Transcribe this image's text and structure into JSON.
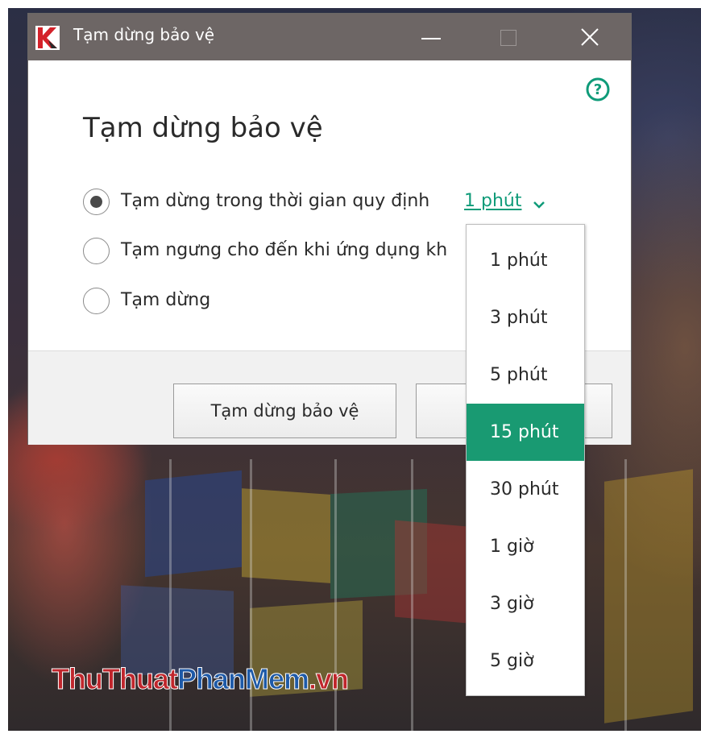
{
  "window": {
    "title": "Tạm dừng bảo vệ",
    "icon": "kaspersky-logo-icon",
    "controls": [
      "minimize-icon",
      "maximize-icon",
      "close-icon"
    ]
  },
  "dialog": {
    "heading": "Tạm dừng bảo vệ",
    "help_icon": "help-icon",
    "options": [
      {
        "label": "Tạm dừng trong thời gian quy định",
        "selected": true
      },
      {
        "label": "Tạm ngưng cho đến khi ứng dụng kh",
        "selected": false
      },
      {
        "label": "Tạm dừng",
        "selected": false
      }
    ],
    "duration_value": "1 phút",
    "buttons": {
      "pause": "Tạm dừng bảo vệ"
    }
  },
  "dropdown": {
    "items": [
      "1 phút",
      "3 phút",
      "5 phút",
      "15 phút",
      "30 phút",
      "1 giờ",
      "3 giờ",
      "5 giờ"
    ],
    "highlighted": "15 phút"
  },
  "watermark": {
    "part1": "ThuThuat",
    "part2": "PhanMem",
    "part3": ".vn"
  },
  "colors": {
    "titlebar": "#6d6665",
    "accent": "#0f9b79",
    "highlight": "#199a72",
    "brand_red": "#c0262c",
    "brand_blue": "#1e5aa8"
  }
}
